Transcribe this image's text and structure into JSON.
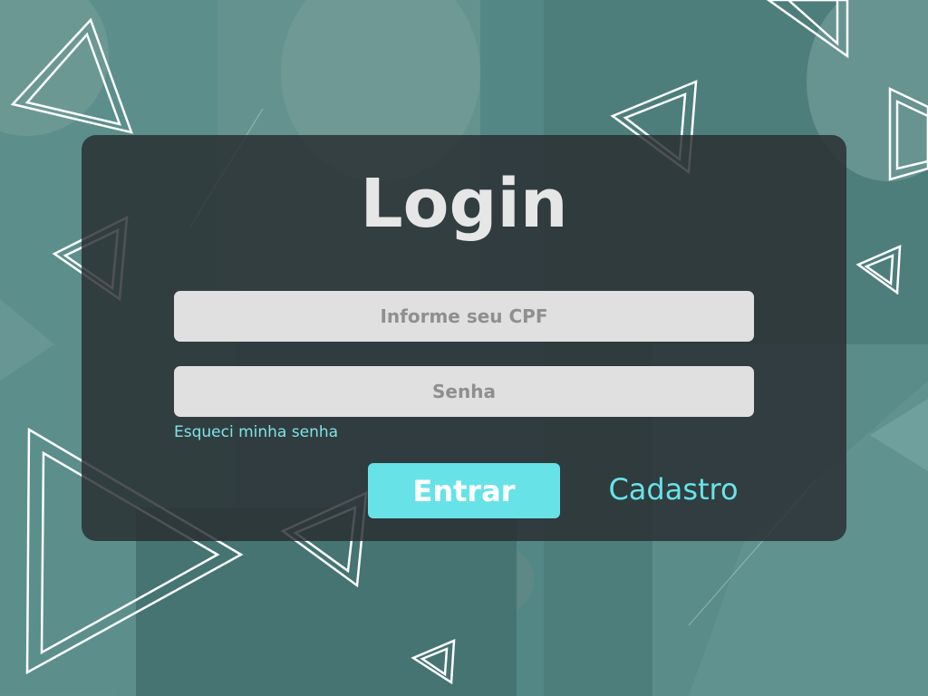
{
  "login": {
    "title": "Login",
    "cpf_placeholder": "Informe seu CPF",
    "password_placeholder": "Senha",
    "forgot_password": "Esqueci minha senha",
    "enter_button": "Entrar",
    "signup_link": "Cadastro"
  },
  "colors": {
    "accent": "#67e3e8",
    "card": "#282c30",
    "input": "#e0e0e0",
    "background": "#4f7f7d"
  },
  "icons": [
    "triangle-outline-decoration"
  ]
}
